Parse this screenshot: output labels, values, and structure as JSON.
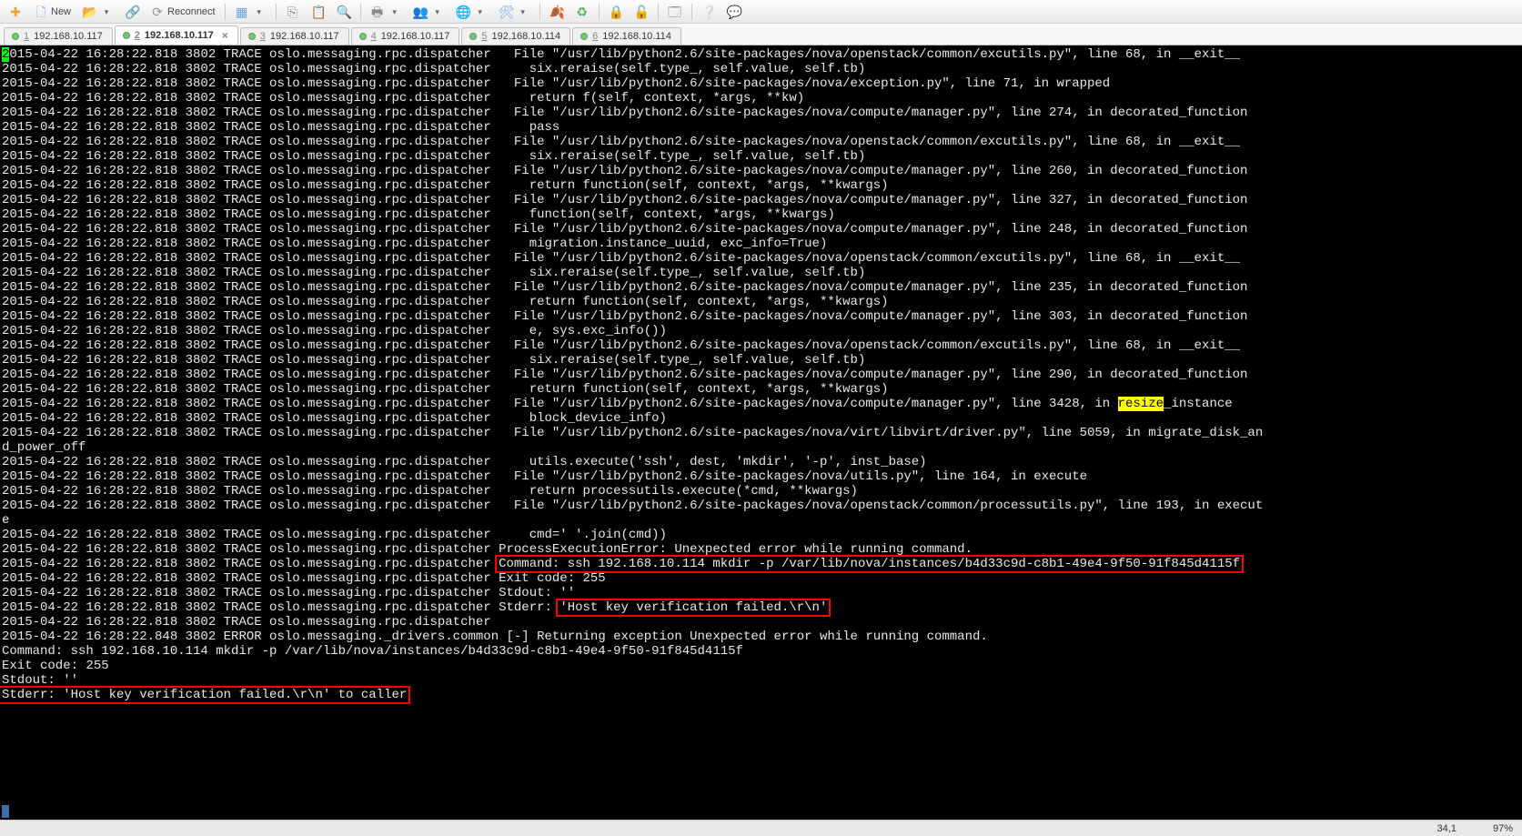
{
  "toolbar": {
    "new_label": "New",
    "reconnect_label": "Reconnect"
  },
  "tabs": [
    {
      "num": "1",
      "label": "192.168.10.117",
      "active": false
    },
    {
      "num": "2",
      "label": "192.168.10.117",
      "active": true
    },
    {
      "num": "3",
      "label": "192.168.10.117",
      "active": false
    },
    {
      "num": "4",
      "label": "192.168.10.117",
      "active": false
    },
    {
      "num": "5",
      "label": "192.168.10.114",
      "active": false
    },
    {
      "num": "6",
      "label": "192.168.10.114",
      "active": false
    }
  ],
  "log": {
    "prefix": "2015-04-22 16:28:22.818 3802 TRACE oslo.messaging.rpc.dispatcher",
    "prefix848err": "2015-04-22 16:28:22.848 3802 ERROR oslo.messaging._drivers.common",
    "line01_a": "2",
    "line01_b": "015-04-22 16:28:22.818 3802 TRACE oslo.messaging.rpc.dispatcher   File \"/usr/lib/python2.6/site-packages/nova/openstack/common/excutils.py\", line 68, in __exit__",
    "line02": "    six.reraise(self.type_, self.value, self.tb)",
    "line03": "  File \"/usr/lib/python2.6/site-packages/nova/exception.py\", line 71, in wrapped",
    "line04": "    return f(self, context, *args, **kw)",
    "line05": "  File \"/usr/lib/python2.6/site-packages/nova/compute/manager.py\", line 274, in decorated_function",
    "line06": "    pass",
    "line07": "  File \"/usr/lib/python2.6/site-packages/nova/openstack/common/excutils.py\", line 68, in __exit__",
    "line08": "    six.reraise(self.type_, self.value, self.tb)",
    "line09": "  File \"/usr/lib/python2.6/site-packages/nova/compute/manager.py\", line 260, in decorated_function",
    "line10": "    return function(self, context, *args, **kwargs)",
    "line11": "  File \"/usr/lib/python2.6/site-packages/nova/compute/manager.py\", line 327, in decorated_function",
    "line12": "    function(self, context, *args, **kwargs)",
    "line13": "  File \"/usr/lib/python2.6/site-packages/nova/compute/manager.py\", line 248, in decorated_function",
    "line14": "    migration.instance_uuid, exc_info=True)",
    "line15": "  File \"/usr/lib/python2.6/site-packages/nova/openstack/common/excutils.py\", line 68, in __exit__",
    "line16": "    six.reraise(self.type_, self.value, self.tb)",
    "line17": "  File \"/usr/lib/python2.6/site-packages/nova/compute/manager.py\", line 235, in decorated_function",
    "line18": "    return function(self, context, *args, **kwargs)",
    "line19": "  File \"/usr/lib/python2.6/site-packages/nova/compute/manager.py\", line 303, in decorated_function",
    "line20": "    e, sys.exc_info())",
    "line21": "  File \"/usr/lib/python2.6/site-packages/nova/openstack/common/excutils.py\", line 68, in __exit__",
    "line22": "    six.reraise(self.type_, self.value, self.tb)",
    "line23": "  File \"/usr/lib/python2.6/site-packages/nova/compute/manager.py\", line 290, in decorated_function",
    "line24": "    return function(self, context, *args, **kwargs)",
    "line25a": "  File \"/usr/lib/python2.6/site-packages/nova/compute/manager.py\", line 3428, in ",
    "line25hl": "resize",
    "line25b": "_instance",
    "line26": "    block_device_info)",
    "line27": "  File \"/usr/lib/python2.6/site-packages/nova/virt/libvirt/driver.py\", line 5059, in migrate_disk_an",
    "wrap1": "d_power_off",
    "line28": "    utils.execute('ssh', dest, 'mkdir', '-p', inst_base)",
    "line29": "  File \"/usr/lib/python2.6/site-packages/nova/utils.py\", line 164, in execute",
    "line30": "    return processutils.execute(*cmd, **kwargs)",
    "line31": "  File \"/usr/lib/python2.6/site-packages/nova/openstack/common/processutils.py\", line 193, in execut",
    "wrap2": "e",
    "line32": "    cmd=' '.join(cmd))",
    "line33": "ProcessExecutionError: Unexpected error while running command.",
    "box1": "Command: ssh 192.168.10.114 mkdir -p /var/lib/nova/instances/b4d33c9d-c8b1-49e4-9f50-91f845d4115f",
    "line34": "Exit code: 255",
    "line35": "Stdout: ''",
    "line36a": "Stderr: ",
    "box2": "'Host key verification failed.\\r\\n'",
    "line37": "[-] Returning exception Unexpected error while running command.",
    "cmdline": "Command: ssh 192.168.10.114 mkdir -p /var/lib/nova/instances/b4d33c9d-c8b1-49e4-9f50-91f845d4115f",
    "exitcode": "Exit code: 255",
    "stdout": "Stdout: ''",
    "box3": "Stderr: 'Host key verification failed.\\r\\n' to caller"
  },
  "status": {
    "pos": "34,1",
    "pct": "97%"
  }
}
